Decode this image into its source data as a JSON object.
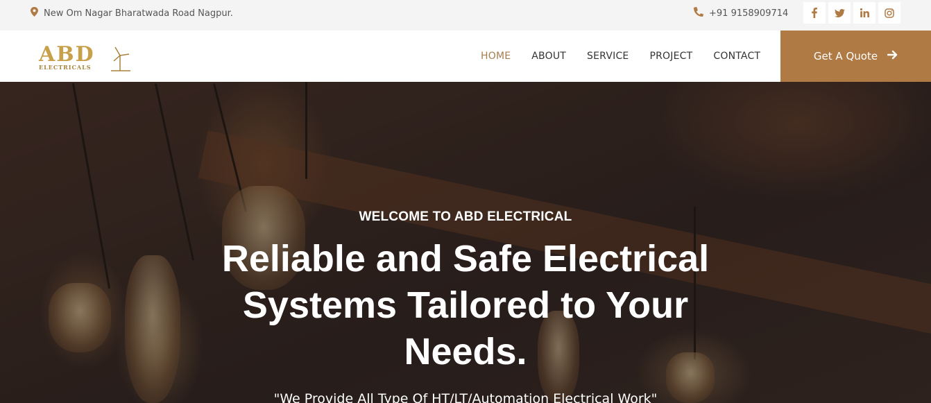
{
  "topbar": {
    "address": "New Om Nagar Bharatwada Road Nagpur.",
    "phone": "+91 9158909714",
    "socials": [
      {
        "icon": "facebook-icon",
        "glyph": "f"
      },
      {
        "icon": "twitter-icon",
        "glyph": "t"
      },
      {
        "icon": "linkedin-icon",
        "glyph": "in"
      },
      {
        "icon": "instagram-icon",
        "glyph": "ig"
      }
    ]
  },
  "logo": {
    "main": "ABD",
    "sub": "ELECTRICALS"
  },
  "nav": {
    "items": [
      {
        "label": "HOME",
        "active": true
      },
      {
        "label": "ABOUT",
        "active": false
      },
      {
        "label": "SERVICE",
        "active": false
      },
      {
        "label": "PROJECT",
        "active": false
      },
      {
        "label": "CONTACT",
        "active": false
      }
    ],
    "quote_label": "Get A Quote"
  },
  "hero": {
    "welcome": "WELCOME TO ABD ELECTRICAL",
    "headline": "Reliable and Safe Electrical Systems Tailored to Your Needs.",
    "tagline": "\"We Provide All Type Of HT/LT/Automation Electrical Work\""
  },
  "colors": {
    "accent": "#b07a45",
    "nav_active": "#a87b4f",
    "topbar_bg": "#f4f4f4"
  }
}
